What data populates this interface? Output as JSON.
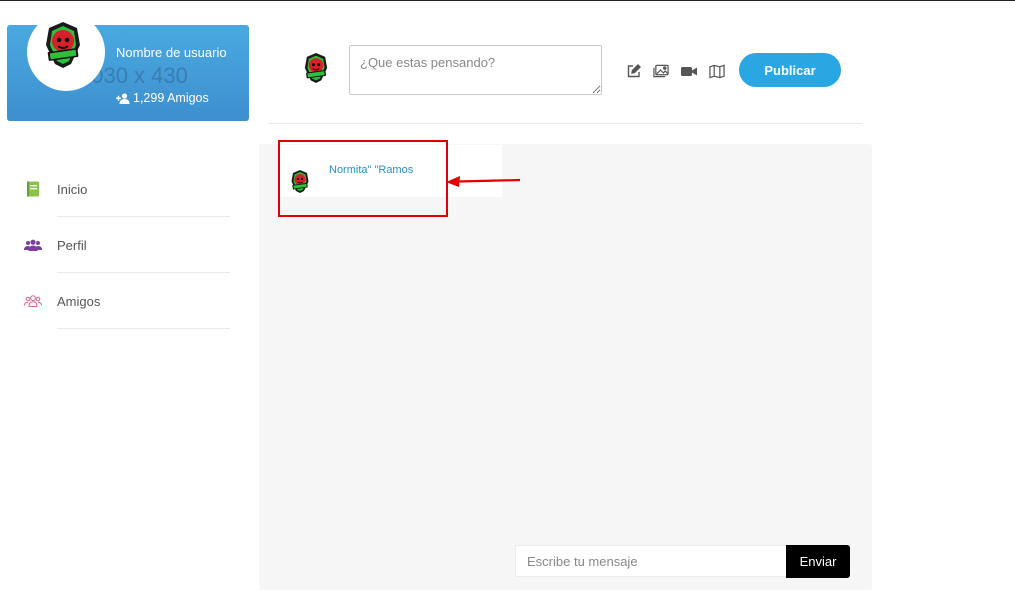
{
  "profile": {
    "name": "Nombre de usuario",
    "watermark": "1030 x 430",
    "friends_label": "1,299 Amigos",
    "friends_icon": "user-plus-icon"
  },
  "nav": {
    "items": [
      {
        "label": "Inicio",
        "icon": "book-icon",
        "color": "#8bc34a"
      },
      {
        "label": "Perfil",
        "icon": "users-icon",
        "color": "#7b3fa0"
      },
      {
        "label": "Amigos",
        "icon": "users-outline-icon",
        "color": "#e0608a"
      }
    ]
  },
  "composer": {
    "placeholder": "¿Que estas pensando?",
    "tools": [
      "edit-icon",
      "image-icon",
      "video-icon",
      "map-icon"
    ],
    "publish_label": "Publicar"
  },
  "chat": {
    "contact_name": "Normita\" \"Ramos",
    "message_placeholder": "Escribe tu mensaje",
    "send_label": "Enviar"
  },
  "colors": {
    "accent": "#2aa6e3",
    "card_gradient_top": "#4aa9e0",
    "card_gradient_bottom": "#3d8fcf",
    "highlight": "#e00000"
  },
  "logo": {
    "lettering_top": "TEAM",
    "lettering_main": "ERLIK"
  }
}
